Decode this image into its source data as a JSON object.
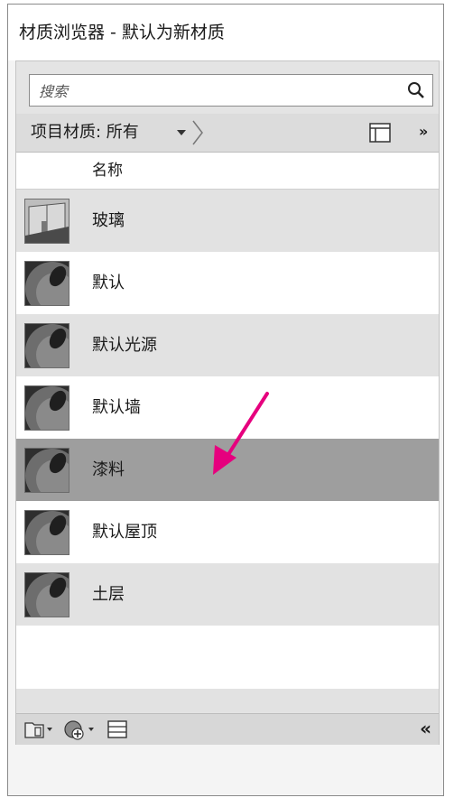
{
  "window": {
    "title": "材质浏览器 - 默认为新材质"
  },
  "search": {
    "placeholder": "搜索"
  },
  "filter": {
    "label": "项目材质: 所有"
  },
  "table": {
    "header_name": "名称",
    "rows": [
      {
        "label": "玻璃",
        "thumb": "glass-thumbnail"
      },
      {
        "label": "默认",
        "thumb": "sphere-thumbnail"
      },
      {
        "label": "默认光源",
        "thumb": "sphere-thumbnail"
      },
      {
        "label": "默认墙",
        "thumb": "sphere-thumbnail"
      },
      {
        "label": "漆料",
        "thumb": "sphere-thumbnail",
        "selected": true
      },
      {
        "label": "默认屋顶",
        "thumb": "sphere-thumbnail"
      },
      {
        "label": "土层",
        "thumb": "sphere-thumbnail"
      }
    ]
  },
  "toolbar": {
    "collapse_label": "«",
    "more_label": "»"
  },
  "colors": {
    "selected_row": "#9e9e9e",
    "annotation_arrow": "#e6007e"
  }
}
